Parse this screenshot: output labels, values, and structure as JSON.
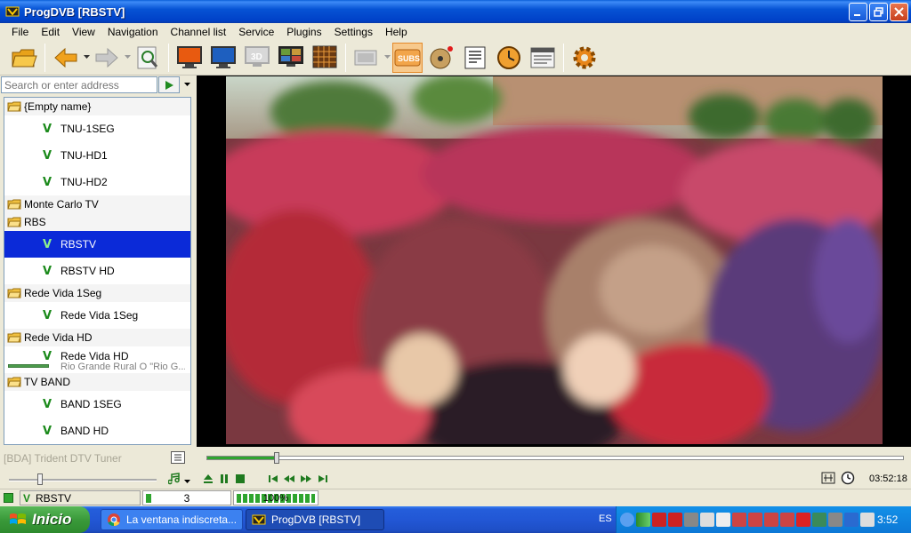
{
  "window": {
    "title": "ProgDVB [RBSTV]"
  },
  "menu": [
    "File",
    "Edit",
    "View",
    "Navigation",
    "Channel list",
    "Service",
    "Plugins",
    "Settings",
    "Help"
  ],
  "toolbar": {
    "icons": [
      "open-folder-icon",
      "back-arrow-icon",
      "forward-arrow-icon",
      "channel-scan-icon",
      "monitor-icon",
      "tv-icon",
      "3d-icon",
      "mosaic-icon",
      "grid-icon",
      "epg-icon",
      "subtitles-icon",
      "record-icon",
      "info-icon",
      "timer-icon",
      "teletext-icon",
      "settings-gear-icon"
    ],
    "subs_label": "SUBS",
    "threed_label": "3D"
  },
  "search": {
    "placeholder": "Search or enter address"
  },
  "channel_list": [
    {
      "group": "{Empty name}",
      "channels": [
        {
          "name": "TNU-1SEG"
        },
        {
          "name": "TNU-HD1"
        },
        {
          "name": "TNU-HD2"
        }
      ]
    },
    {
      "group": "Monte Carlo TV",
      "channels": []
    },
    {
      "group": "RBS",
      "channels": [
        {
          "name": "RBSTV",
          "selected": true
        },
        {
          "name": "RBSTV HD"
        }
      ]
    },
    {
      "group": "Rede Vida 1Seg",
      "channels": [
        {
          "name": "Rede Vida 1Seg"
        }
      ]
    },
    {
      "group": "Rede Vida HD",
      "channels": [
        {
          "name": "Rede Vida HD",
          "subtitle": "Rio Grande Rural O \"Rio G..."
        }
      ]
    },
    {
      "group": "TV BAND",
      "channels": [
        {
          "name": "BAND 1SEG"
        },
        {
          "name": "BAND HD"
        }
      ]
    }
  ],
  "player": {
    "tuner": "[BDA] Trident DTV Tuner",
    "seek_position": 0.1,
    "volume_position": 0.21,
    "time": "03:52:18"
  },
  "status": {
    "channel": "RBSTV",
    "number": "3",
    "signal": "100%"
  },
  "taskbar": {
    "start": "Inicio",
    "tasks": [
      "La ventana indiscreta...",
      "ProgDVB [RBSTV]"
    ],
    "lang": "ES",
    "clock": "3:52"
  },
  "colors": {
    "accent": "#0b2ad8",
    "titlebar": "#0653d4",
    "signal_green": "#2fa52f"
  }
}
